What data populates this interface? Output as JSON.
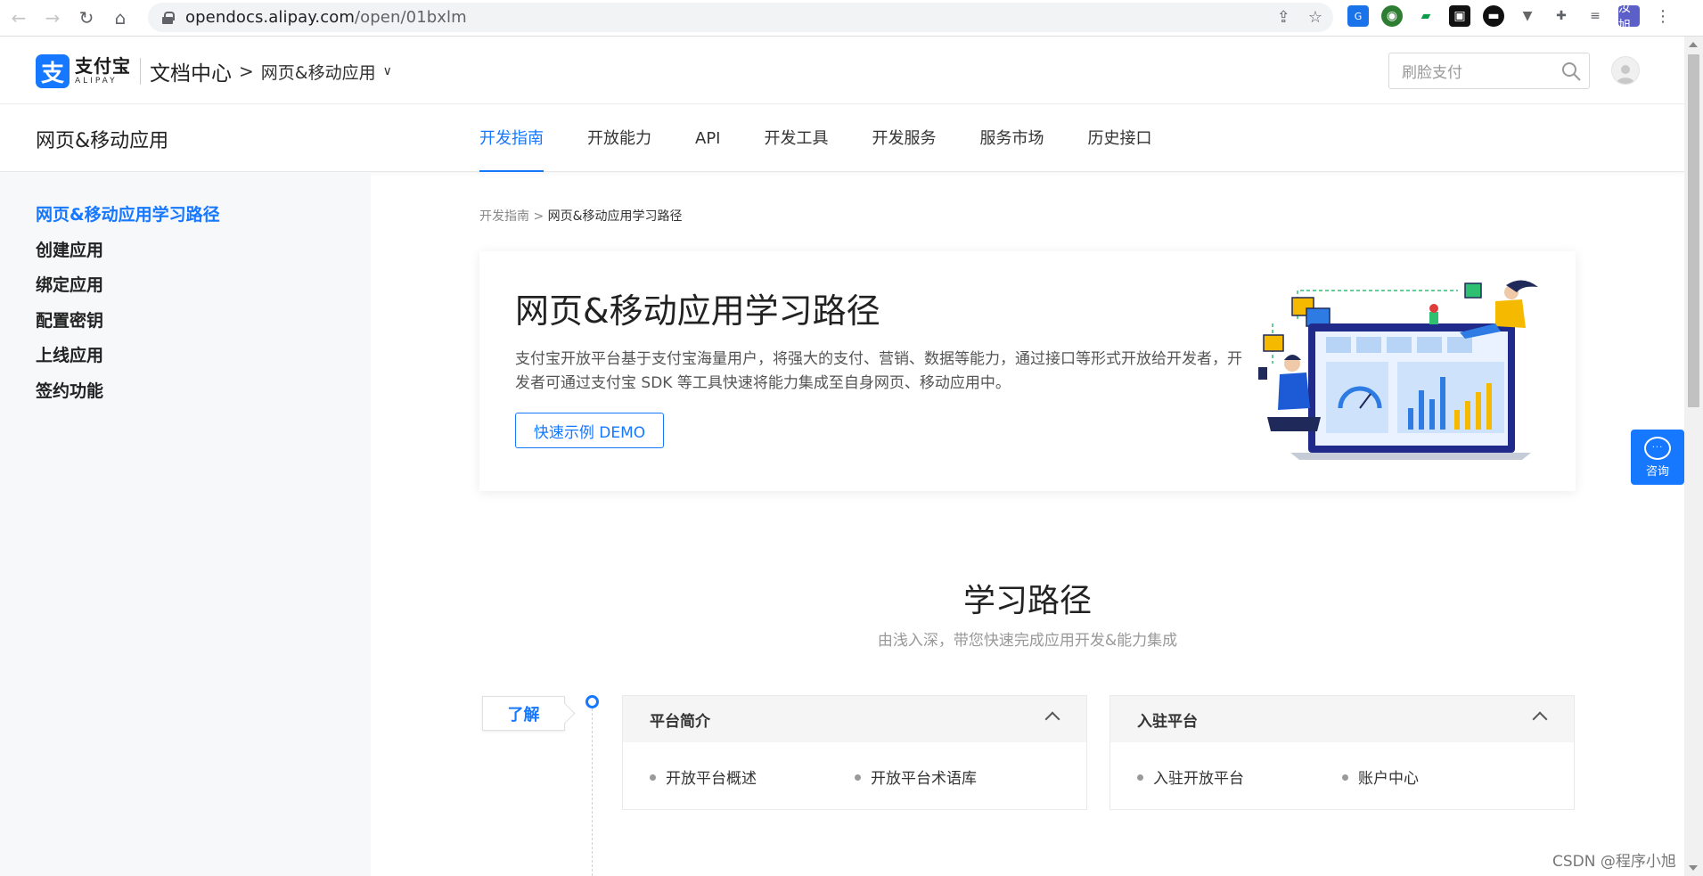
{
  "browser": {
    "url_host": "opendocs.alipay.com",
    "url_path": "/open/01bxlm",
    "profile_label": "汝旭",
    "icons": [
      "back-icon",
      "forward-icon",
      "reload-icon",
      "home-icon",
      "lock-icon",
      "share-icon",
      "bookmark-star-icon",
      "extensions-puzzle-icon",
      "reading-list-icon",
      "menu-dots-icon"
    ]
  },
  "header": {
    "logo_cn": "支付宝",
    "logo_en": "ALIPAY",
    "logo_mark": "支",
    "doc_center": "文档中心",
    "crumb_sep": ">",
    "app_type": "网页&移动应用",
    "caret": "∨",
    "search_placeholder": "刷脸支付"
  },
  "subnav": {
    "title": "网页&移动应用",
    "tabs": [
      {
        "label": "开发指南",
        "active": true
      },
      {
        "label": "开放能力"
      },
      {
        "label": "API"
      },
      {
        "label": "开发工具"
      },
      {
        "label": "开发服务"
      },
      {
        "label": "服务市场"
      },
      {
        "label": "历史接口"
      }
    ]
  },
  "sidebar": {
    "items": [
      {
        "label": "网页&移动应用学习路径",
        "active": true
      },
      {
        "label": "创建应用"
      },
      {
        "label": "绑定应用"
      },
      {
        "label": "配置密钥"
      },
      {
        "label": "上线应用"
      },
      {
        "label": "签约功能"
      }
    ]
  },
  "breadcrumb": {
    "parent": "开发指南",
    "sep": " > ",
    "current": "网页&移动应用学习路径"
  },
  "hero": {
    "title": "网页&移动应用学习路径",
    "description": "支付宝开放平台基于支付宝海量用户，将强大的支付、营销、数据等能力，通过接口等形式开放给开发者，开发者可通过支付宝 SDK 等工具快速将能力集成至自身网页、移动应用中。",
    "button": "快速示例 DEMO"
  },
  "learning": {
    "title": "学习路径",
    "subtitle": "由浅入深，带您快速完成应用开发&能力集成",
    "stage": "了解",
    "cards": [
      {
        "title": "平台简介",
        "links": [
          "开放平台概述",
          "开放平台术语库"
        ]
      },
      {
        "title": "入驻平台",
        "links": [
          "入驻开放平台",
          "账户中心"
        ]
      }
    ]
  },
  "consult": {
    "label": "咨询"
  },
  "watermark": "CSDN @程序小旭",
  "colors": {
    "accent": "#1677ff",
    "sidebar_bg": "#f7f8fa",
    "card_head_bg": "#f5f5f5"
  }
}
